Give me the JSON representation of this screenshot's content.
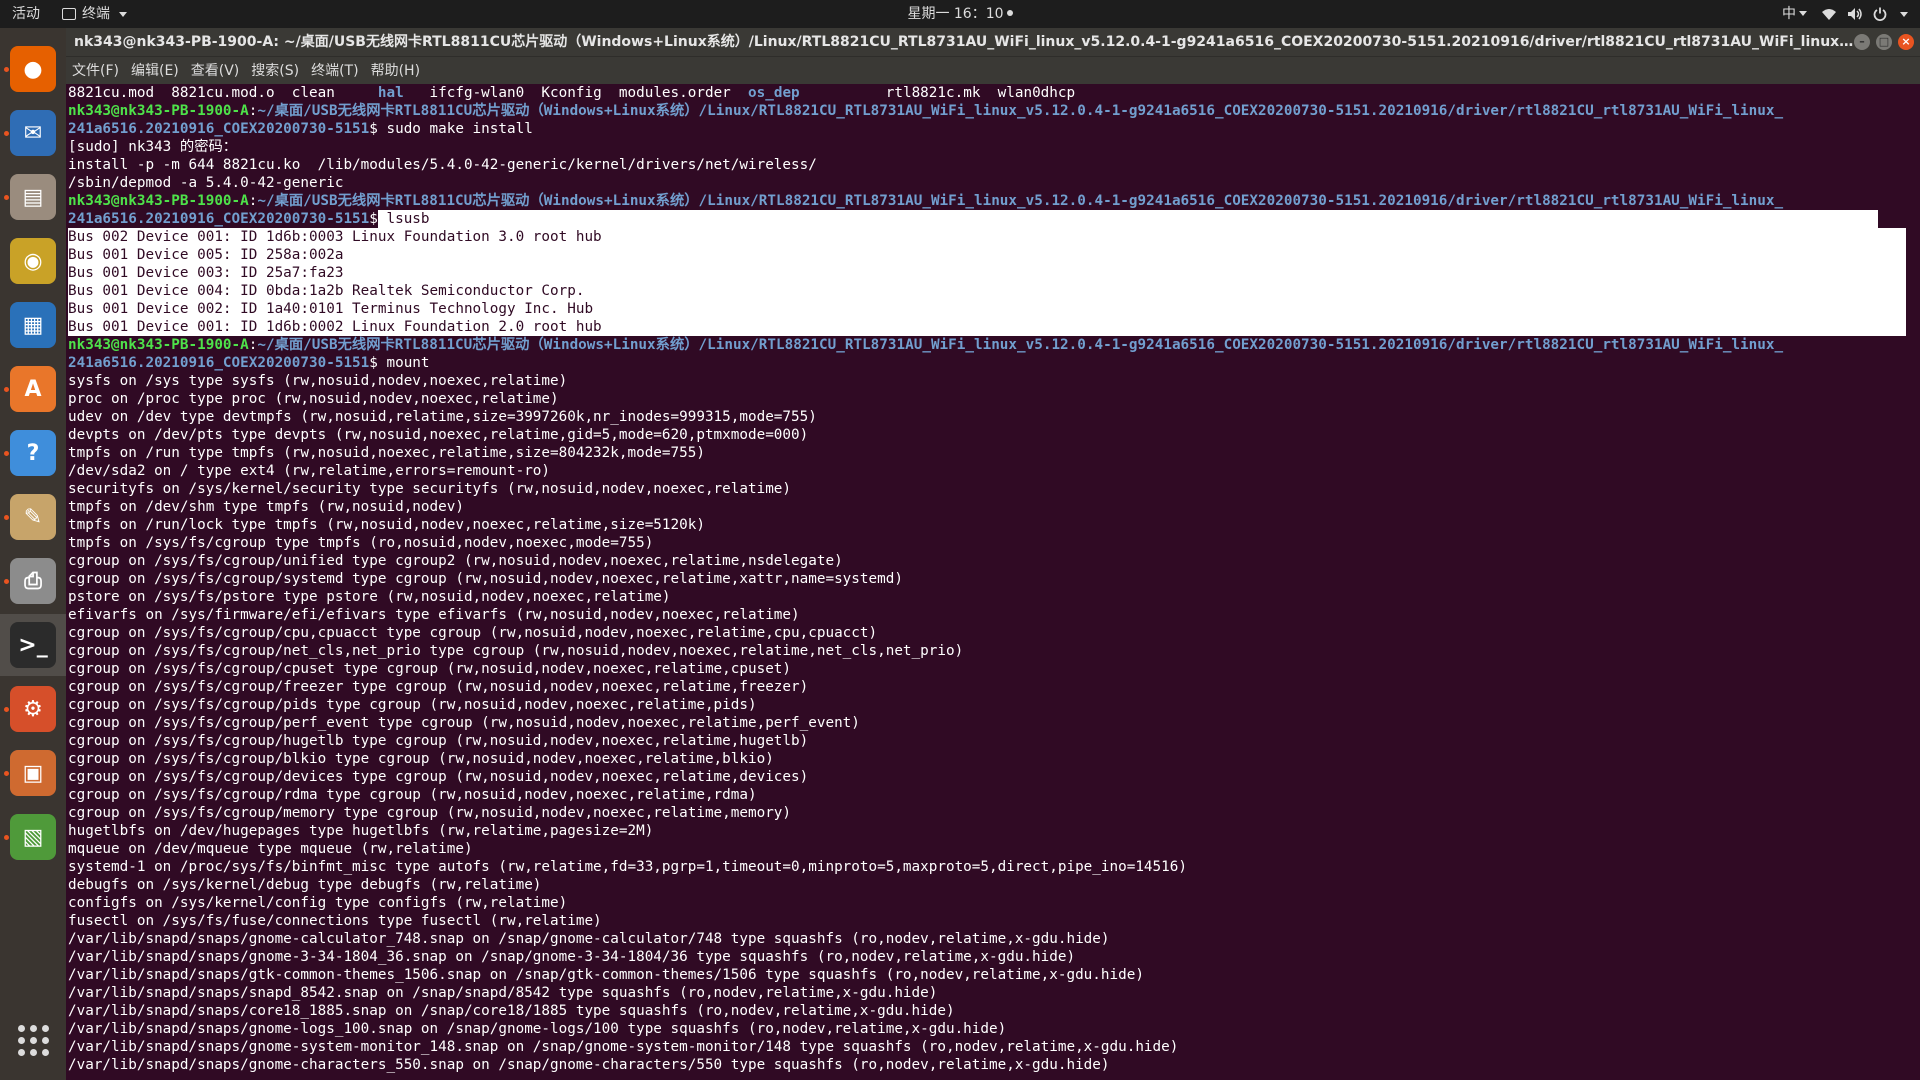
{
  "topbar": {
    "activities": "活动",
    "app_menu": "终端",
    "clock": "星期一 16：10",
    "input_method": "中"
  },
  "window": {
    "title": "nk343@nk343-PB-1900-A: ~/桌面/USB无线网卡RTL8811CU芯片驱动（Windows+Linux系统）/Linux/RTL8821CU_RTL8731AU_WiFi_linux_v5.12.0.4-1-g9241a6516_COEX20200730-5151.20210916/driver/rtl8821CU_rtl8731AU_WiFi_linux_v5.12.0.4-1-g9241a6516_2...",
    "menu": [
      "文件(F)",
      "编辑(E)",
      "查看(V)",
      "搜索(S)",
      "终端(T)",
      "帮助(H)"
    ]
  },
  "dock": {
    "items": [
      {
        "name": "firefox-icon",
        "glyph": "●",
        "color": "#e66000"
      },
      {
        "name": "thunderbird-icon",
        "glyph": "✉",
        "color": "#2f6db5"
      },
      {
        "name": "files-icon",
        "glyph": "▤",
        "color": "#9a8c7e"
      },
      {
        "name": "rhythmbox-icon",
        "glyph": "◉",
        "color": "#c9a227"
      },
      {
        "name": "writer-icon",
        "glyph": "▦",
        "color": "#2a71b9"
      },
      {
        "name": "software-icon",
        "glyph": "A",
        "color": "#e9762a"
      },
      {
        "name": "help-icon",
        "glyph": "?",
        "color": "#3f8edb"
      },
      {
        "name": "text-editor-icon",
        "glyph": "✎",
        "color": "#c7a46a"
      },
      {
        "name": "printer-icon",
        "glyph": "⎙",
        "color": "#8c8c8c"
      },
      {
        "name": "terminal-icon",
        "glyph": ">_",
        "color": "#2b2b2b"
      },
      {
        "name": "settings-icon",
        "glyph": "⚙",
        "color": "#d64f2a"
      },
      {
        "name": "archive-icon",
        "glyph": "▣",
        "color": "#cf6a30"
      },
      {
        "name": "spreadsheet-icon",
        "glyph": "▧",
        "color": "#4f9a3a"
      }
    ]
  },
  "terminal": {
    "prompt_user": "nk343@nk343-PB-1900-A",
    "prompt_path": "~/桌面/USB无线网卡RTL8811CU芯片驱动（Windows+Linux系统）/Linux/RTL8821CU_RTL8731AU_WiFi_linux_v5.12.0.4-1-g9241a6516_COEX20200730-5151.20210916/driver/rtl8821CU_rtl8731AU_WiFi_linux_",
    "prompt_path_wrap": "241a6516.20210916_COEX20200730-5151",
    "ls_line": {
      "files1": "8821cu.mod  8821cu.mod.o  clean     ",
      "dir1": "hal",
      "files2": "   ifcfg-wlan0  Kconfig  modules.order  ",
      "dir2": "os_dep",
      "files3": "          rtl8821c.mk  wlan0dhcp"
    },
    "cmd_install": "sudo make install",
    "install_output": [
      "[sudo] nk343 的密码：",
      "install -p -m 644 8821cu.ko  /lib/modules/5.4.0-42-generic/kernel/drivers/net/wireless/",
      "/sbin/depmod -a 5.4.0-42-generic"
    ],
    "cmd_lsusb": "lsusb",
    "lsusb_output": [
      "Bus 002 Device 001: ID 1d6b:0003 Linux Foundation 3.0 root hub",
      "Bus 001 Device 005: ID 258a:002a",
      "Bus 001 Device 003: ID 25a7:fa23",
      "Bus 001 Device 004: ID 0bda:1a2b Realtek Semiconductor Corp.",
      "Bus 001 Device 002: ID 1a40:0101 Terminus Technology Inc. Hub",
      "Bus 001 Device 001: ID 1d6b:0002 Linux Foundation 2.0 root hub"
    ],
    "cmd_mount": "mount",
    "mount_output": [
      "sysfs on /sys type sysfs (rw,nosuid,nodev,noexec,relatime)",
      "proc on /proc type proc (rw,nosuid,nodev,noexec,relatime)",
      "udev on /dev type devtmpfs (rw,nosuid,relatime,size=3997260k,nr_inodes=999315,mode=755)",
      "devpts on /dev/pts type devpts (rw,nosuid,noexec,relatime,gid=5,mode=620,ptmxmode=000)",
      "tmpfs on /run type tmpfs (rw,nosuid,noexec,relatime,size=804232k,mode=755)",
      "/dev/sda2 on / type ext4 (rw,relatime,errors=remount-ro)",
      "securityfs on /sys/kernel/security type securityfs (rw,nosuid,nodev,noexec,relatime)",
      "tmpfs on /dev/shm type tmpfs (rw,nosuid,nodev)",
      "tmpfs on /run/lock type tmpfs (rw,nosuid,nodev,noexec,relatime,size=5120k)",
      "tmpfs on /sys/fs/cgroup type tmpfs (ro,nosuid,nodev,noexec,mode=755)",
      "cgroup on /sys/fs/cgroup/unified type cgroup2 (rw,nosuid,nodev,noexec,relatime,nsdelegate)",
      "cgroup on /sys/fs/cgroup/systemd type cgroup (rw,nosuid,nodev,noexec,relatime,xattr,name=systemd)",
      "pstore on /sys/fs/pstore type pstore (rw,nosuid,nodev,noexec,relatime)",
      "efivarfs on /sys/firmware/efi/efivars type efivarfs (rw,nosuid,nodev,noexec,relatime)",
      "cgroup on /sys/fs/cgroup/cpu,cpuacct type cgroup (rw,nosuid,nodev,noexec,relatime,cpu,cpuacct)",
      "cgroup on /sys/fs/cgroup/net_cls,net_prio type cgroup (rw,nosuid,nodev,noexec,relatime,net_cls,net_prio)",
      "cgroup on /sys/fs/cgroup/cpuset type cgroup (rw,nosuid,nodev,noexec,relatime,cpuset)",
      "cgroup on /sys/fs/cgroup/freezer type cgroup (rw,nosuid,nodev,noexec,relatime,freezer)",
      "cgroup on /sys/fs/cgroup/pids type cgroup (rw,nosuid,nodev,noexec,relatime,pids)",
      "cgroup on /sys/fs/cgroup/perf_event type cgroup (rw,nosuid,nodev,noexec,relatime,perf_event)",
      "cgroup on /sys/fs/cgroup/hugetlb type cgroup (rw,nosuid,nodev,noexec,relatime,hugetlb)",
      "cgroup on /sys/fs/cgroup/blkio type cgroup (rw,nosuid,nodev,noexec,relatime,blkio)",
      "cgroup on /sys/fs/cgroup/devices type cgroup (rw,nosuid,nodev,noexec,relatime,devices)",
      "cgroup on /sys/fs/cgroup/rdma type cgroup (rw,nosuid,nodev,noexec,relatime,rdma)",
      "cgroup on /sys/fs/cgroup/memory type cgroup (rw,nosuid,nodev,noexec,relatime,memory)",
      "hugetlbfs on /dev/hugepages type hugetlbfs (rw,relatime,pagesize=2M)",
      "mqueue on /dev/mqueue type mqueue (rw,relatime)",
      "systemd-1 on /proc/sys/fs/binfmt_misc type autofs (rw,relatime,fd=33,pgrp=1,timeout=0,minproto=5,maxproto=5,direct,pipe_ino=14516)",
      "debugfs on /sys/kernel/debug type debugfs (rw,relatime)",
      "configfs on /sys/kernel/config type configfs (rw,relatime)",
      "fusectl on /sys/fs/fuse/connections type fusectl (rw,relatime)",
      "/var/lib/snapd/snaps/gnome-calculator_748.snap on /snap/gnome-calculator/748 type squashfs (ro,nodev,relatime,x-gdu.hide)",
      "/var/lib/snapd/snaps/gnome-3-34-1804_36.snap on /snap/gnome-3-34-1804/36 type squashfs (ro,nodev,relatime,x-gdu.hide)",
      "/var/lib/snapd/snaps/gtk-common-themes_1506.snap on /snap/gtk-common-themes/1506 type squashfs (ro,nodev,relatime,x-gdu.hide)",
      "/var/lib/snapd/snaps/snapd_8542.snap on /snap/snapd/8542 type squashfs (ro,nodev,relatime,x-gdu.hide)",
      "/var/lib/snapd/snaps/core18_1885.snap on /snap/core18/1885 type squashfs (ro,nodev,relatime,x-gdu.hide)",
      "/var/lib/snapd/snaps/gnome-logs_100.snap on /snap/gnome-logs/100 type squashfs (ro,nodev,relatime,x-gdu.hide)",
      "/var/lib/snapd/snaps/gnome-system-monitor_148.snap on /snap/gnome-system-monitor/148 type squashfs (ro,nodev,relatime,x-gdu.hide)",
      "/var/lib/snapd/snaps/gnome-characters_550.snap on /snap/gnome-characters/550 type squashfs (ro,nodev,relatime,x-gdu.hide)"
    ]
  },
  "colors": {
    "terminal_bg": "#300a24",
    "prompt_user": "#4ee24a",
    "prompt_path": "#729fcf",
    "accent": "#e95420"
  }
}
